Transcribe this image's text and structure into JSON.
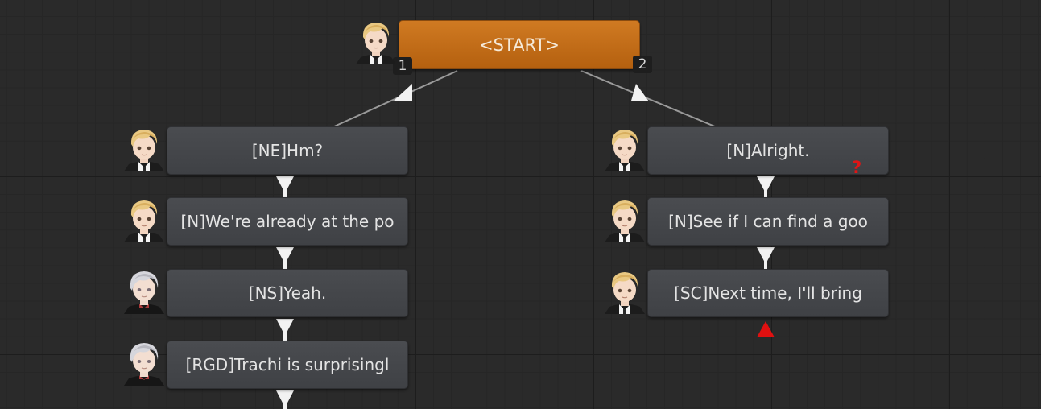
{
  "graph": {
    "start": {
      "label": "<START>",
      "ports": [
        "1",
        "2"
      ]
    },
    "left_branch": [
      {
        "label": "[NE]Hm?",
        "speaker": "blonde-boy"
      },
      {
        "label": "[N]We're already at the po",
        "speaker": "blonde-boy"
      },
      {
        "label": "[NS]Yeah.",
        "speaker": "silver-haired-boy"
      },
      {
        "label": "[RGD]Trachi is surprisingl",
        "speaker": "silver-haired-boy"
      }
    ],
    "right_branch": [
      {
        "label": "[N]Alright.",
        "speaker": "blonde-boy",
        "marker": "?"
      },
      {
        "label": "[N]See if I can find a goo",
        "speaker": "blonde-boy"
      },
      {
        "label": "[SC]Next time, I'll bring",
        "speaker": "blonde-boy"
      }
    ]
  },
  "colors": {
    "background": "#2a2a2a",
    "start_node": "#c56d1a",
    "node": "#46484c",
    "connector": "#9a9a9a",
    "end_marker": "#e01010"
  }
}
